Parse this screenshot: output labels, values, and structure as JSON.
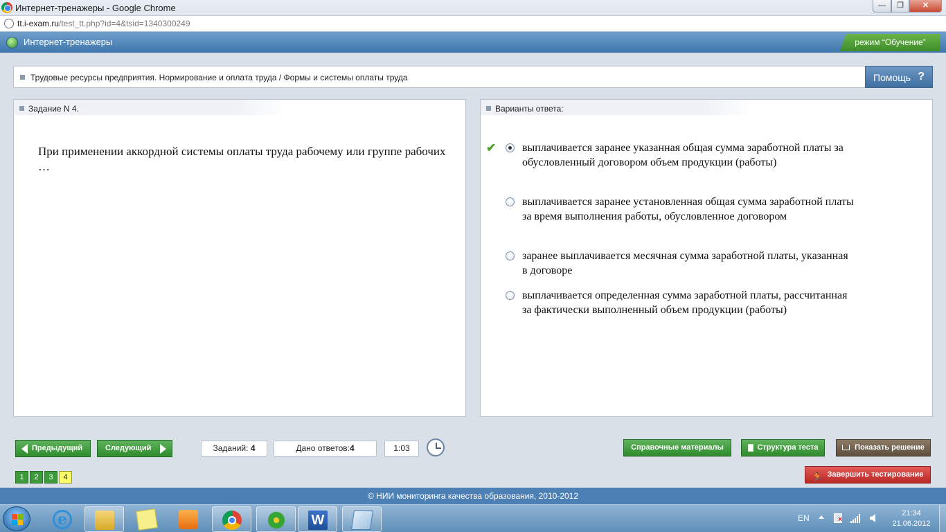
{
  "browser": {
    "window_title": "Интернет-тренажеры - Google Chrome",
    "url_host": "tt.i-exam.ru",
    "url_path": "/test_tt.php?id=4&tsid=1340300249",
    "controls": {
      "minimize": "—",
      "maximize": "❐",
      "close": "✕"
    }
  },
  "app": {
    "title": "Интернет-тренажеры",
    "mode": "режим “Обучение”"
  },
  "breadcrumb": "Трудовые ресурсы предприятия. Нормирование и оплата труда / Формы и системы оплаты труда",
  "help": {
    "label": "Помощь",
    "icon": "?"
  },
  "task": {
    "header": "Задание N 4.",
    "question": "При применении аккордной системы оплаты труда рабочему или группе рабочих …"
  },
  "answers": {
    "header": "Варианты ответа:",
    "options": [
      {
        "text": "выплачивается заранее указанная общая сумма заработной платы за обусловленный договором объем продукции (работы)",
        "selected": true,
        "correct": true
      },
      {
        "text": "выплачивается заранее установленная общая сумма заработной платы за время выполнения работы, обусловленное договором",
        "selected": false
      },
      {
        "text": "заранее выплачивается месячная сумма заработной платы, указанная в договоре",
        "selected": false
      },
      {
        "text": "выплачивается определенная сумма заработной платы, рассчитанная за фактически выполненный объем продукции (работы)",
        "selected": false
      }
    ]
  },
  "nav": {
    "prev_label": "Предыдущий",
    "next_label": "Следующий",
    "tasks_label": "Заданий:",
    "tasks_value": "4",
    "answers_label": "Дано ответов:",
    "answers_value": "4",
    "timer": "1:03",
    "pages": [
      "1",
      "2",
      "3",
      "4"
    ],
    "current_page": "4"
  },
  "actions": {
    "reference": "Справочные материалы",
    "structure": "Структура теста",
    "show_solution": "Показать решение",
    "finish": "Завершить тестирование"
  },
  "footer": "© НИИ мониторинга качества образования, 2010-2012",
  "taskbar": {
    "lang": "EN",
    "time": "21:34",
    "date": "21.06.2012",
    "items": [
      "internet-explorer-icon",
      "windows-explorer-icon",
      "sticky-notes-icon",
      "media-player-icon",
      "chrome-icon",
      "icq-icon",
      "word-icon",
      "notes-icon"
    ]
  }
}
